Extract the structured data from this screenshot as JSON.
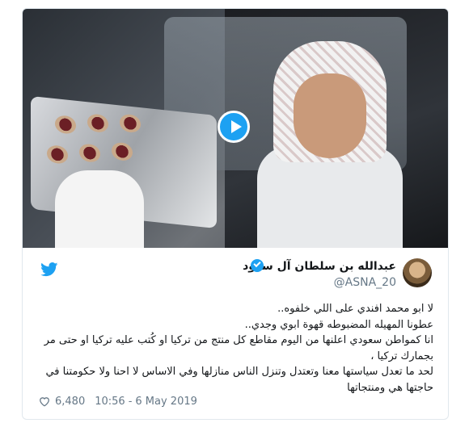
{
  "tweet_card": {
    "author_name": "عبدالله بن سلطان آل سعود",
    "author_handle": "@ASNA_20",
    "text_lines": [
      "لا ابو محمد افندي على اللي خلفوه..",
      "عطونا المهيله المضبوطه قهوة ابوي وجدي..",
      "انا كمواطن سعودي اعلنها من اليوم مقاطع كل منتج من تركيا او كُتب عليه تركيا او حتى مر",
      "بجمارك تركيا ،",
      "لحد ما تعدل سياستها معنا وتعتدل وتنزل الناس منازلها وفي الاساس لا احنا ولا حكومتنا في",
      "حاجتها هي ومنتجاتها"
    ],
    "likes": "6,480",
    "time": "10:56",
    "date": "6 May 2019",
    "icons": {
      "play": "play-icon",
      "verified": "verified-badge-icon",
      "brand": "twitter-bird-icon",
      "like": "heart-icon"
    },
    "colors": {
      "accent": "#1da1f2",
      "text": "#14171a",
      "muted": "#657786"
    }
  }
}
